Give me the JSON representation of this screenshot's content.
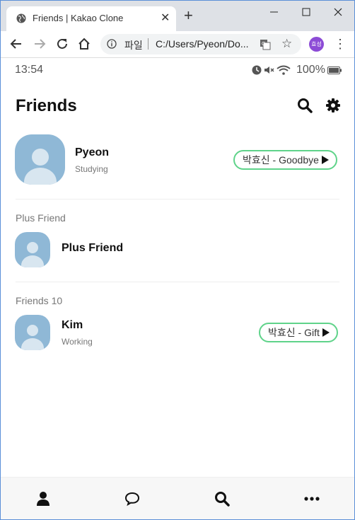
{
  "browser": {
    "tab_title": "Friends | Kakao Clone",
    "tab_close": "✕",
    "new_tab": "+",
    "scheme_label": "파일",
    "url": "C:/Users/Pyeon/Do...",
    "star": "☆",
    "profile_initials": "효성",
    "menu_dots": "⋮",
    "icons": [
      "globe-icon",
      "minimize-icon",
      "maximize-icon",
      "window-close-icon",
      "back-icon",
      "forward-icon",
      "reload-icon",
      "home-icon",
      "info-icon",
      "translate-icon",
      "star-icon",
      "more-vert-icon"
    ]
  },
  "status_bar": {
    "time": "13:54",
    "battery": "100%",
    "icons": [
      "clock-icon",
      "mute-icon",
      "wifi-icon",
      "battery-icon"
    ]
  },
  "header": {
    "title": "Friends",
    "icons": [
      "search-icon",
      "gear-icon"
    ]
  },
  "me": {
    "name": "Pyeon",
    "status": "Studying",
    "music": "박효신 - Goodbye"
  },
  "plus_section": {
    "label": "Plus Friend",
    "item_name": "Plus Friend"
  },
  "friends_section": {
    "label": "Friends 10",
    "friends": [
      {
        "name": "Kim",
        "status": "Working",
        "music": "박효신 - Gift"
      }
    ]
  },
  "tabbar": {
    "icons": [
      "person-icon",
      "chat-bubble-icon",
      "search-icon",
      "more-icon"
    ]
  },
  "colors": {
    "accent_border": "#5fd38a",
    "avatar_bg": "#8fb8d6",
    "avatar_fg": "#d8e6f0",
    "profile": "#8c4bd6"
  }
}
